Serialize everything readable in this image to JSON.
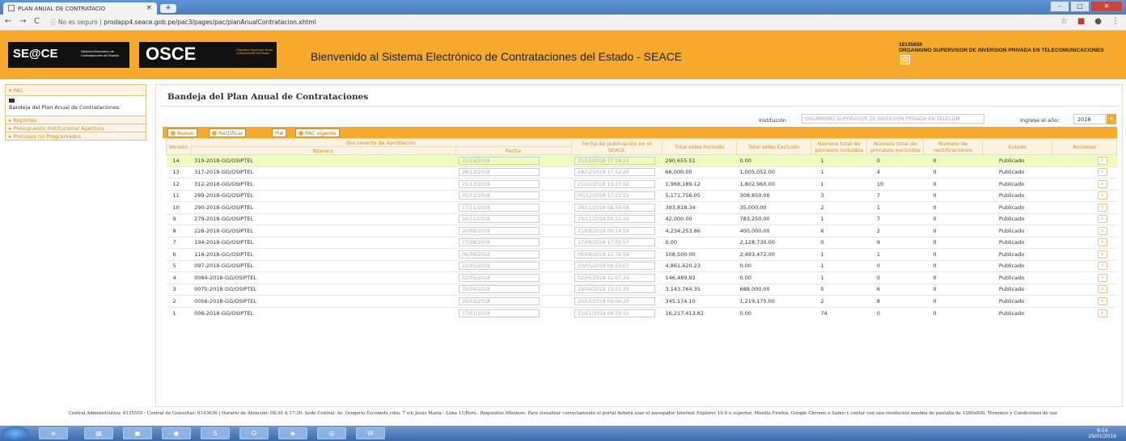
{
  "browser": {
    "tab_title": "PLAN ANUAL DE CONTRATACIO",
    "security": "No es seguro",
    "url": "prodapp4.seace.gob.pe/pac3/pages/pac/planAnualContratacion.xhtml"
  },
  "header": {
    "welcome": "Bienvenido al Sistema Electrónico de Contrataciones del Estado - SEACE",
    "user_id": "18135659",
    "org": "ORGANISMO SUPERVISOR DE INVERSION PRIVADA EN TELECOMUNICACIONES",
    "logo1_text": "SE@CE",
    "logo1_sub": "Sistema Electrónico de Contrataciones del Estado",
    "logo2_text": "OSCE",
    "logo2_sub": "Organismo Supervisor de las Contrataciones del Estado"
  },
  "sidebar": {
    "pac": "PAC",
    "bandeja": "Bandeja del Plan Anual de Contrataciones",
    "items": [
      "Reportes",
      "Presupuesto Institucional Apertura",
      "Procesos no Programados"
    ]
  },
  "main": {
    "title": "Bandeja del Plan Anual de Contrataciones",
    "institucion_label": "Institución",
    "institucion_value": "ORGANISMO SUPERVISOR DE INVERSION PRIVADA EN TELECOM",
    "year_label": "Ingrese el año:",
    "year_value": "2018",
    "buttons": [
      "Nuevo",
      "Rectificar",
      "PIA",
      "PAC vigente"
    ]
  },
  "table": {
    "headers": {
      "version": "Versión",
      "documento": "Documento de Aprobación",
      "numero": "Número",
      "fecha": "Fecha",
      "fecha_pub": "Fecha de publicación en el SEACE",
      "total_incluido": "Total soles Incluido",
      "total_excluido": "Total soles Excluido",
      "num_incluidos": "Número total de procesos incluidos",
      "num_excluidos": "Número total de procesos excluidos",
      "num_rect": "Número de rectificaciones",
      "estado": "Estado",
      "acciones": "Acciones"
    },
    "rows": [
      {
        "version": "14",
        "numero": "319-2018-GG/OSIPTEL",
        "fecha": "31/12/2018",
        "pub": "31/12/2018 17:59:22",
        "inc": "290,655.51",
        "exc": "0.00",
        "ni": "1",
        "ne": "0",
        "nr": "0",
        "estado": "Publicado"
      },
      {
        "version": "13",
        "numero": "317-2018-GG/OSIPTEL",
        "fecha": "28/12/2018",
        "pub": "28/12/2018 17:52:20",
        "inc": "66,000.00",
        "exc": "1,005,052.00",
        "ni": "1",
        "ne": "4",
        "nr": "0",
        "estado": "Publicado"
      },
      {
        "version": "12",
        "numero": "312-2018-GG/OSIPTEL",
        "fecha": "21/12/2018",
        "pub": "21/12/2018 19:37:02",
        "inc": "1,968,189.12",
        "exc": "1,802,960.00",
        "ni": "1",
        "ne": "10",
        "nr": "0",
        "estado": "Publicado"
      },
      {
        "version": "11",
        "numero": "299-2018-GG/OSIPTEL",
        "fecha": "05/12/2018",
        "pub": "05/12/2018 17:12:32",
        "inc": "5,171,756.05",
        "exc": "308,850.00",
        "ni": "3",
        "ne": "7",
        "nr": "0",
        "estado": "Publicado"
      },
      {
        "version": "10",
        "numero": "290-2018-GG/OSIPTEL",
        "fecha": "27/11/2018",
        "pub": "28/11/2018 08:59:08",
        "inc": "393,818.34",
        "exc": "35,000.00",
        "ni": "2",
        "ne": "1",
        "nr": "0",
        "estado": "Publicado"
      },
      {
        "version": "9",
        "numero": "279-2018-GG/OSIPTEL",
        "fecha": "16/11/2018",
        "pub": "19/11/2018 09:22:49",
        "inc": "42,000.00",
        "exc": "783,250.00",
        "ni": "1",
        "ne": "7",
        "nr": "0",
        "estado": "Publicado"
      },
      {
        "version": "8",
        "numero": "228-2018-GG/OSIPTEL",
        "fecha": "20/09/2018",
        "pub": "21/09/2018 09:14:59",
        "inc": "4,234,253.86",
        "exc": "400,000.00",
        "ni": "6",
        "ne": "2",
        "nr": "0",
        "estado": "Publicado"
      },
      {
        "version": "7",
        "numero": "194-2018-GG/OSIPTEL",
        "fecha": "17/08/2018",
        "pub": "17/08/2018 17:05:57",
        "inc": "0.00",
        "exc": "2,128,730.00",
        "ni": "0",
        "ne": "9",
        "nr": "0",
        "estado": "Publicado"
      },
      {
        "version": "6",
        "numero": "116-2018-GG/OSIPTEL",
        "fecha": "06/08/2018",
        "pub": "06/08/2018 12:34:54",
        "inc": "108,500.00",
        "exc": "2,493,472.00",
        "ni": "1",
        "ne": "1",
        "nr": "0",
        "estado": "Publicado"
      },
      {
        "version": "5",
        "numero": "097-2018-GG/OSIPTEL",
        "fecha": "22/05/2018",
        "pub": "23/05/2018 08:55:07",
        "inc": "4,861,620.23",
        "exc": "0.00",
        "ni": "1",
        "ne": "0",
        "nr": "0",
        "estado": "Publicado"
      },
      {
        "version": "4",
        "numero": "0084-2018-GG/OSIPTEL",
        "fecha": "02/05/2018",
        "pub": "02/05/2018 12:07:34",
        "inc": "146,489.92",
        "exc": "0.00",
        "ni": "1",
        "ne": "0",
        "nr": "0",
        "estado": "Publicado"
      },
      {
        "version": "3",
        "numero": "0075-2018-GG/OSIPTEL",
        "fecha": "19/04/2018",
        "pub": "19/04/2018 13:21:30",
        "inc": "3,143,764.35",
        "exc": "688,000.00",
        "ni": "5",
        "ne": "6",
        "nr": "0",
        "estado": "Publicado"
      },
      {
        "version": "2",
        "numero": "0056-2018-GG/OSIPTEL",
        "fecha": "19/03/2018",
        "pub": "20/03/2018 09:06:20",
        "inc": "345,174.10",
        "exc": "1,219,175.00",
        "ni": "2",
        "ne": "8",
        "nr": "0",
        "estado": "Publicado"
      },
      {
        "version": "1",
        "numero": "006-2018-GG/OSIPTEL",
        "fecha": "17/01/2018",
        "pub": "22/01/2018 08:59:10",
        "inc": "16,217,413.82",
        "exc": "0.00",
        "ni": "74",
        "ne": "0",
        "nr": "0",
        "estado": "Publicado"
      }
    ]
  },
  "footer": "Central Administrativa: 6135555 - Central de Consultas: 6143636 | Horario de Atención: 08:30 A 17:30. Sede Central: Av. Gregorio Escobedo cdra. 7 s/n Jesús María - Lima 11/Perú.. Requisitos Mínimos: Para visualizar correctamente el portal deberá usar el navegador Internet Explorer 10.0 ó superior, Mozilla Firefox, Google Chrome o Safari y contar con una resolución mínima de pantalla de 1280x800. Términos y Condiciones de uso",
  "taskbar": {
    "time": "9:14",
    "date": "29/01/2019"
  },
  "colors": {
    "accent": "#f5a92d",
    "selected_row": "#eefcc0"
  }
}
